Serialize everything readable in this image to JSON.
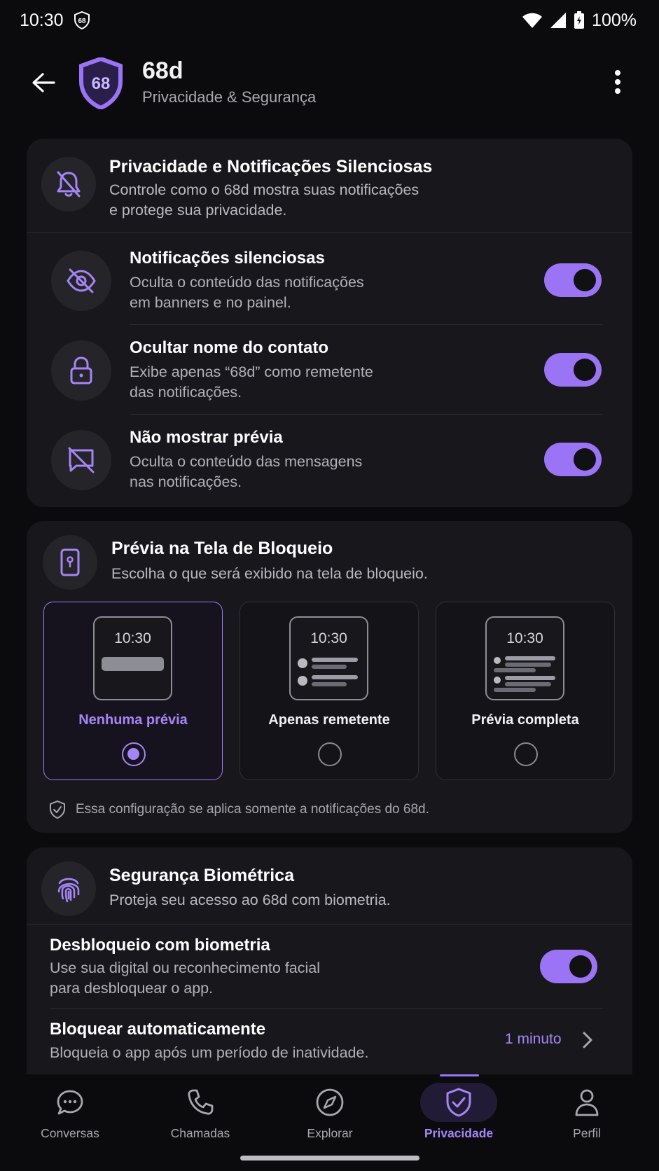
{
  "status_bar": {
    "time": "10:30",
    "badge": "68",
    "battery": "100%"
  },
  "app_bar": {
    "logo_text": "68",
    "title": "68d",
    "subtitle": "Privacidade & Segurança"
  },
  "card_notifications": {
    "title": "Privacidade e Notificações Silenciosas",
    "description_line1": "Controle como o 68d mostra suas notificações",
    "description_line2": "e protege sua privacidade.",
    "rows": [
      {
        "title": "Notificações silenciosas",
        "desc1": "Oculta o conteúdo das notificações",
        "desc2": "em banners e no painel.",
        "enabled": true,
        "icon": "eye-off-icon"
      },
      {
        "title": "Ocultar nome do contato",
        "desc1": "Exibe apenas “68d” como remetente",
        "desc2": "das notificações.",
        "enabled": true,
        "icon": "lock-icon"
      },
      {
        "title": "Não mostrar prévia",
        "desc1": "Oculta o conteúdo das mensagens",
        "desc2": "nas notificações.",
        "enabled": true,
        "icon": "message-off-icon"
      }
    ]
  },
  "card_lockscreen": {
    "title": "Prévia na Tela de Bloqueio",
    "description": "Escolha o que será exibido na tela de bloqueio.",
    "options": [
      {
        "label": "Nenhuma prévia",
        "time": "10:30",
        "selected": true
      },
      {
        "label": "Apenas remetente",
        "time": "10:30",
        "selected": false
      },
      {
        "label": "Prévia completa",
        "time": "10:30",
        "selected": false
      }
    ],
    "footnote": "Essa configuração se aplica somente a notificações do 68d."
  },
  "card_biometric": {
    "title": "Segurança Biométrica",
    "description": "Proteja seu acesso ao 68d com biometria.",
    "unlock": {
      "title": "Desbloqueio com biometria",
      "desc1": "Use sua digital ou reconhecimento facial",
      "desc2": "para desbloquear o app.",
      "enabled": true
    },
    "autolock": {
      "title": "Bloquear automaticamente",
      "desc": "Bloqueia o app após um período de inatividade.",
      "value": "1 minuto"
    }
  },
  "bottom_nav": [
    {
      "label": "Conversas",
      "icon": "chat-icon",
      "active": false
    },
    {
      "label": "Chamadas",
      "icon": "phone-icon",
      "active": false
    },
    {
      "label": "Explorar",
      "icon": "compass-icon",
      "active": false
    },
    {
      "label": "Privacidade",
      "icon": "shield-icon",
      "active": true
    },
    {
      "label": "Perfil",
      "icon": "person-icon",
      "active": false
    }
  ],
  "colors": {
    "accent": "#9a74f4",
    "accent_text": "#a585f6",
    "card": "#18181c",
    "background": "#0b0b0d"
  }
}
